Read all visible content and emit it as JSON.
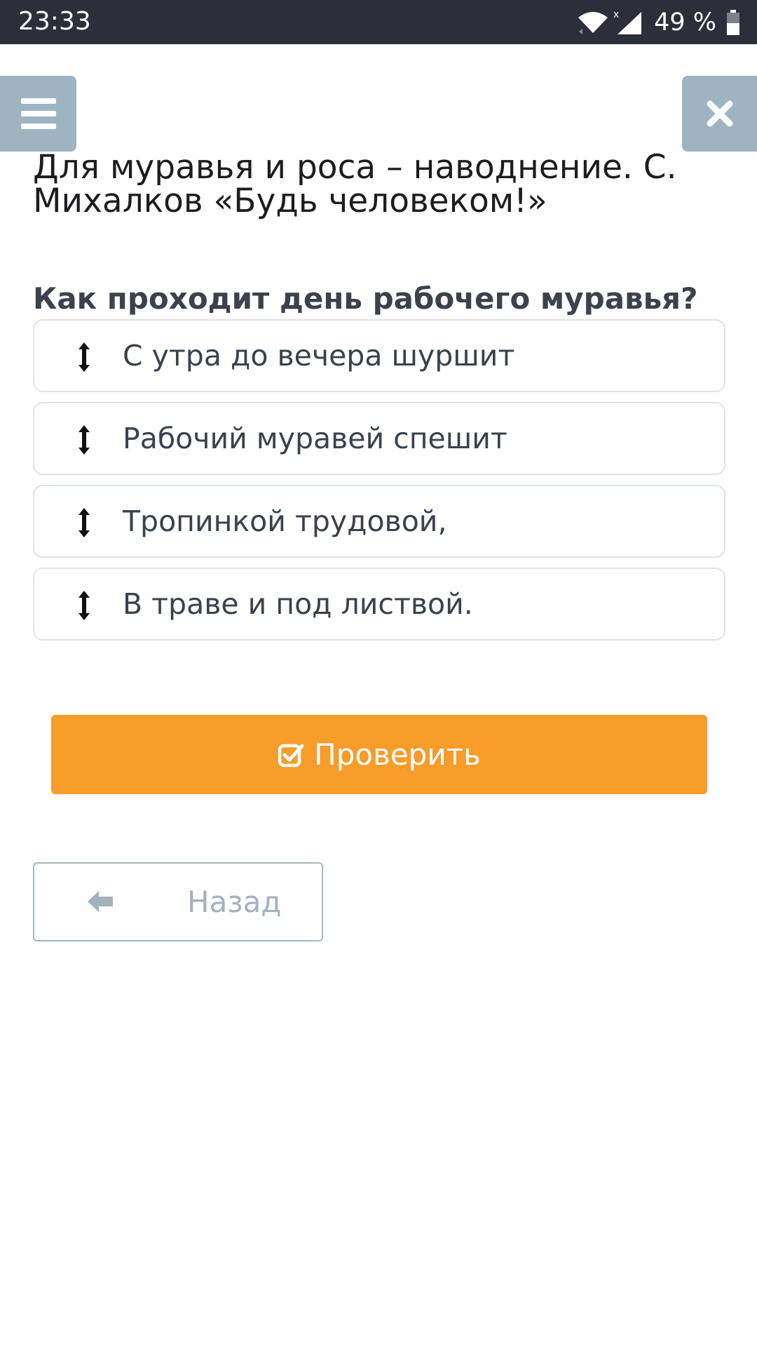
{
  "status_bar": {
    "time": "23:33",
    "battery": "49 %",
    "icons": [
      "wifi-icon",
      "signal-icon",
      "battery-icon"
    ]
  },
  "header": {
    "menu_icon": "hamburger-menu-icon",
    "close_icon": "close-icon"
  },
  "title": "Для муравья и роса – наводнение. С. Михалков «Будь человеком!»",
  "question": "Как проходит день рабочего муравья?",
  "items": [
    {
      "label": "С утра до вечера шуршит",
      "icon": "drag-vertical-icon"
    },
    {
      "label": "Рабочий муравей спешит",
      "icon": "drag-vertical-icon"
    },
    {
      "label": "Тропинкой трудовой,",
      "icon": "drag-vertical-icon"
    },
    {
      "label": "В траве и под листвой.",
      "icon": "drag-vertical-icon"
    }
  ],
  "check_button": {
    "label": "Проверить",
    "icon": "check-square-icon"
  },
  "back_button": {
    "label": "Назад",
    "icon": "arrow-left-icon"
  },
  "colors": {
    "status_bar": "#2c2f3a",
    "nav_button": "#9fb4c1",
    "accent": "#f89c2a",
    "text": "#3b414d",
    "border": "#dfe3e7"
  }
}
